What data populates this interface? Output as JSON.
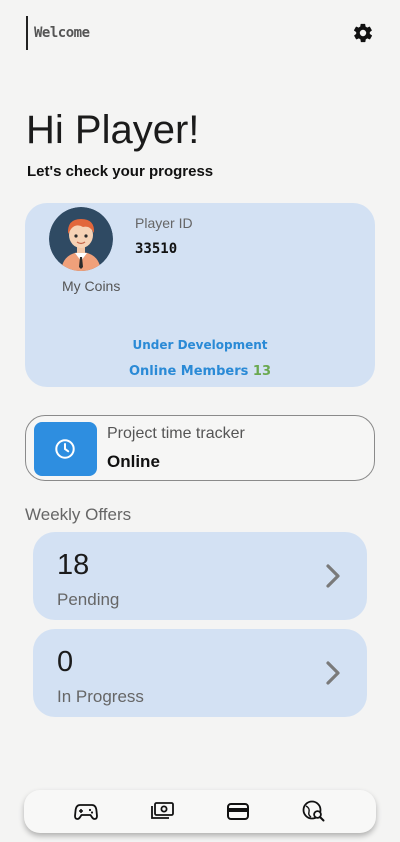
{
  "header": {
    "welcome": "Welcome"
  },
  "greeting": {
    "title": "Hi Player!",
    "subtitle": "Let's check your progress"
  },
  "profile": {
    "player_id_label": "Player ID",
    "player_id": "33510",
    "coins_label": "My Coins",
    "status": "Under Development",
    "members_label": "Online Members",
    "members_count": "13"
  },
  "tracker": {
    "title": "Project time tracker",
    "status": "Online"
  },
  "offers": {
    "title": "Weekly Offers",
    "items": [
      {
        "count": "18",
        "label": "Pending"
      },
      {
        "count": "0",
        "label": "In Progress"
      }
    ]
  },
  "nav": {
    "items": [
      {
        "icon": "gamepad-icon"
      },
      {
        "icon": "money-icon"
      },
      {
        "icon": "wallet-icon"
      },
      {
        "icon": "globe-search-icon"
      }
    ]
  },
  "colors": {
    "card": "#d3e1f3",
    "accent_blue": "#2e8ee0",
    "members_count": "#6aa84f",
    "background": "#f4f4f3"
  }
}
